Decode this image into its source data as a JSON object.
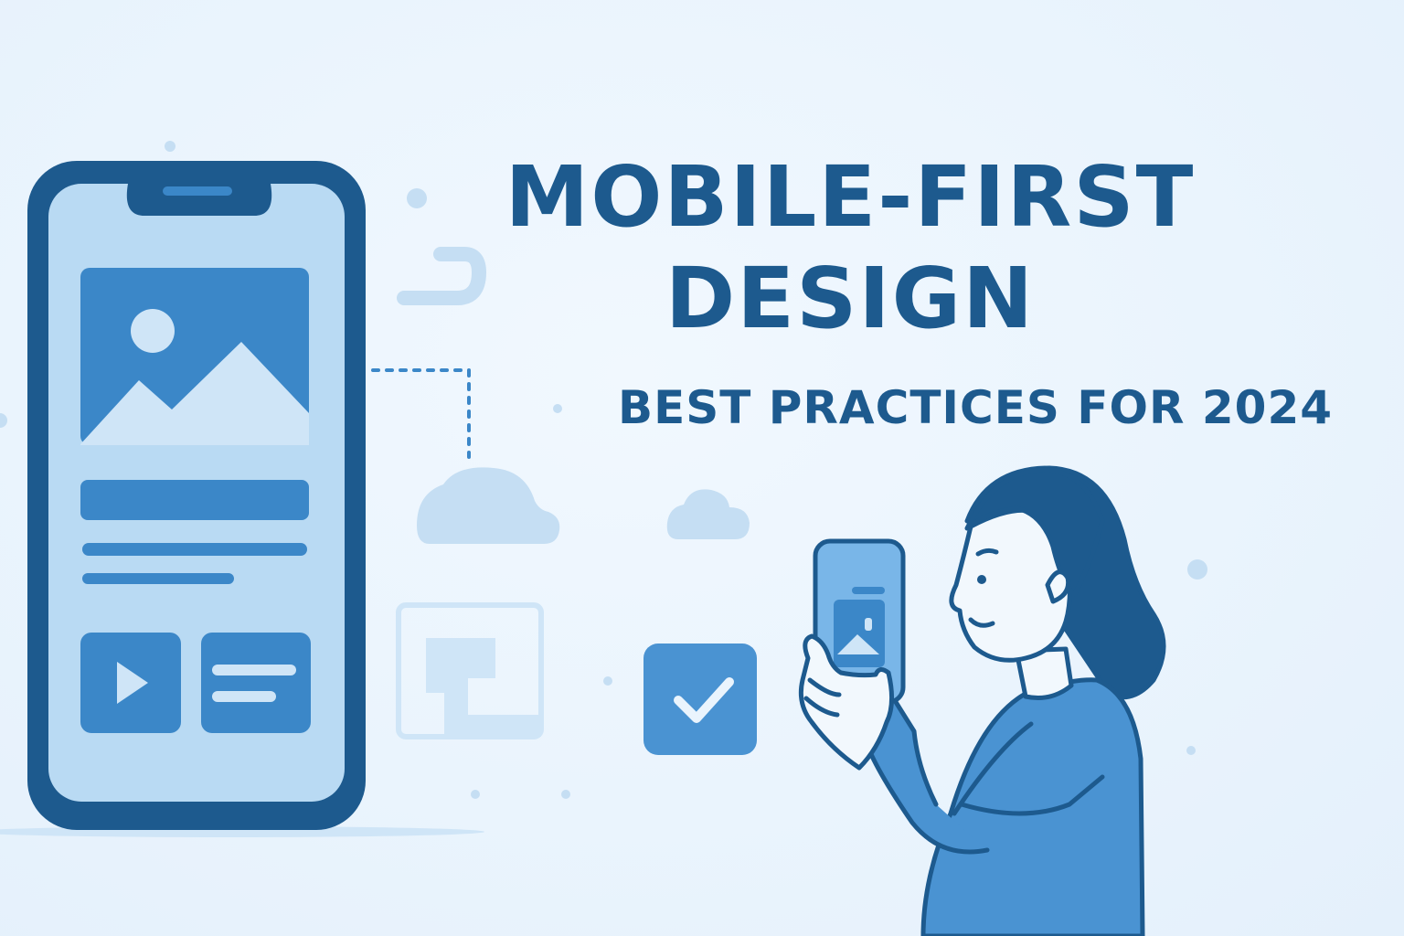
{
  "title": {
    "line1": "MOBILE-FIRST",
    "line2": "DESIGN"
  },
  "subtitle": "BEST PRACTICES FOR 2024",
  "icons": [
    "smartphone-illustration",
    "image-placeholder-icon",
    "play-icon",
    "text-card-icon",
    "cloud-icon",
    "layout-frame-icon",
    "checkmark-icon",
    "woman-holding-phone-illustration"
  ],
  "colors": {
    "background": "#eaf4fd",
    "navy": "#1d5a8e",
    "primary_blue": "#3b87c8",
    "light_blue": "#b9daf3",
    "pale_blue": "#cfe5f7"
  }
}
